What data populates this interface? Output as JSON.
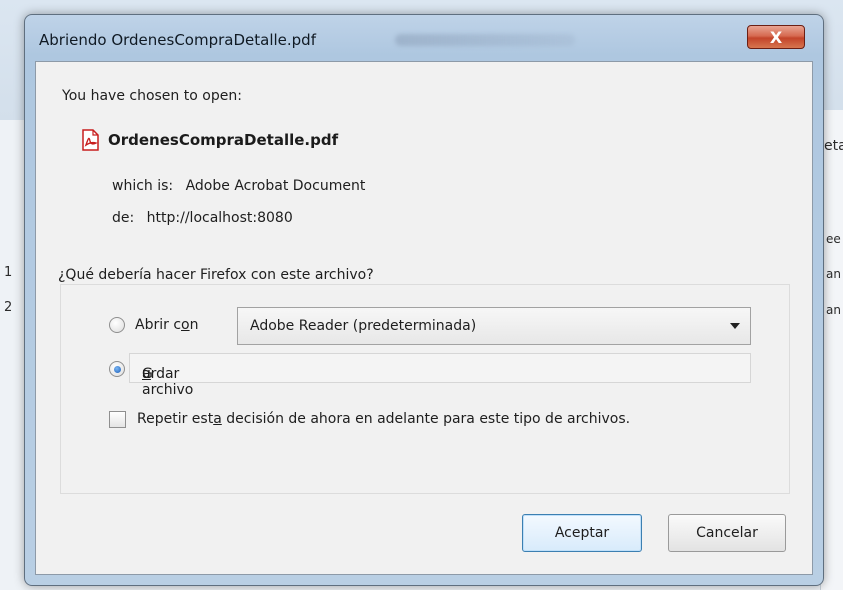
{
  "background": {
    "left_numbers": [
      "1",
      "2"
    ],
    "right_fragments": [
      "eta",
      "ee",
      "an",
      "an"
    ]
  },
  "dialog": {
    "title": "Abriendo OrdenesCompraDetalle.pdf",
    "close_label": "X",
    "intro": "You have chosen to open:",
    "file": {
      "name": "OrdenesCompraDetalle.pdf",
      "icon": "pdf-icon",
      "type_label": "which is:",
      "type_value": "Adobe Acrobat Document",
      "source_label": "de:",
      "source_value": "http://localhost:8080"
    },
    "question": "¿Qué debería hacer Firefox con este archivo?",
    "options": {
      "open_with": {
        "label_pre": "Abrir c",
        "label_accel": "o",
        "label_post": "n",
        "checked": false,
        "app_selected": "Adobe Reader  (predeterminada)"
      },
      "save_file": {
        "label_pre": "G",
        "label_accel": "u",
        "label_post": "ardar archivo",
        "checked": true
      },
      "remember": {
        "label_pre": "Repetir est",
        "label_accel": "a",
        "label_post": " decisión de ahora en adelante para este tipo de archivos.",
        "checked": false
      }
    },
    "buttons": {
      "accept": "Aceptar",
      "cancel": "Cancelar"
    }
  },
  "colors": {
    "close_red": "#c3442a",
    "radio_blue": "#1d5fb8",
    "pdf_red": "#c81e1e"
  }
}
